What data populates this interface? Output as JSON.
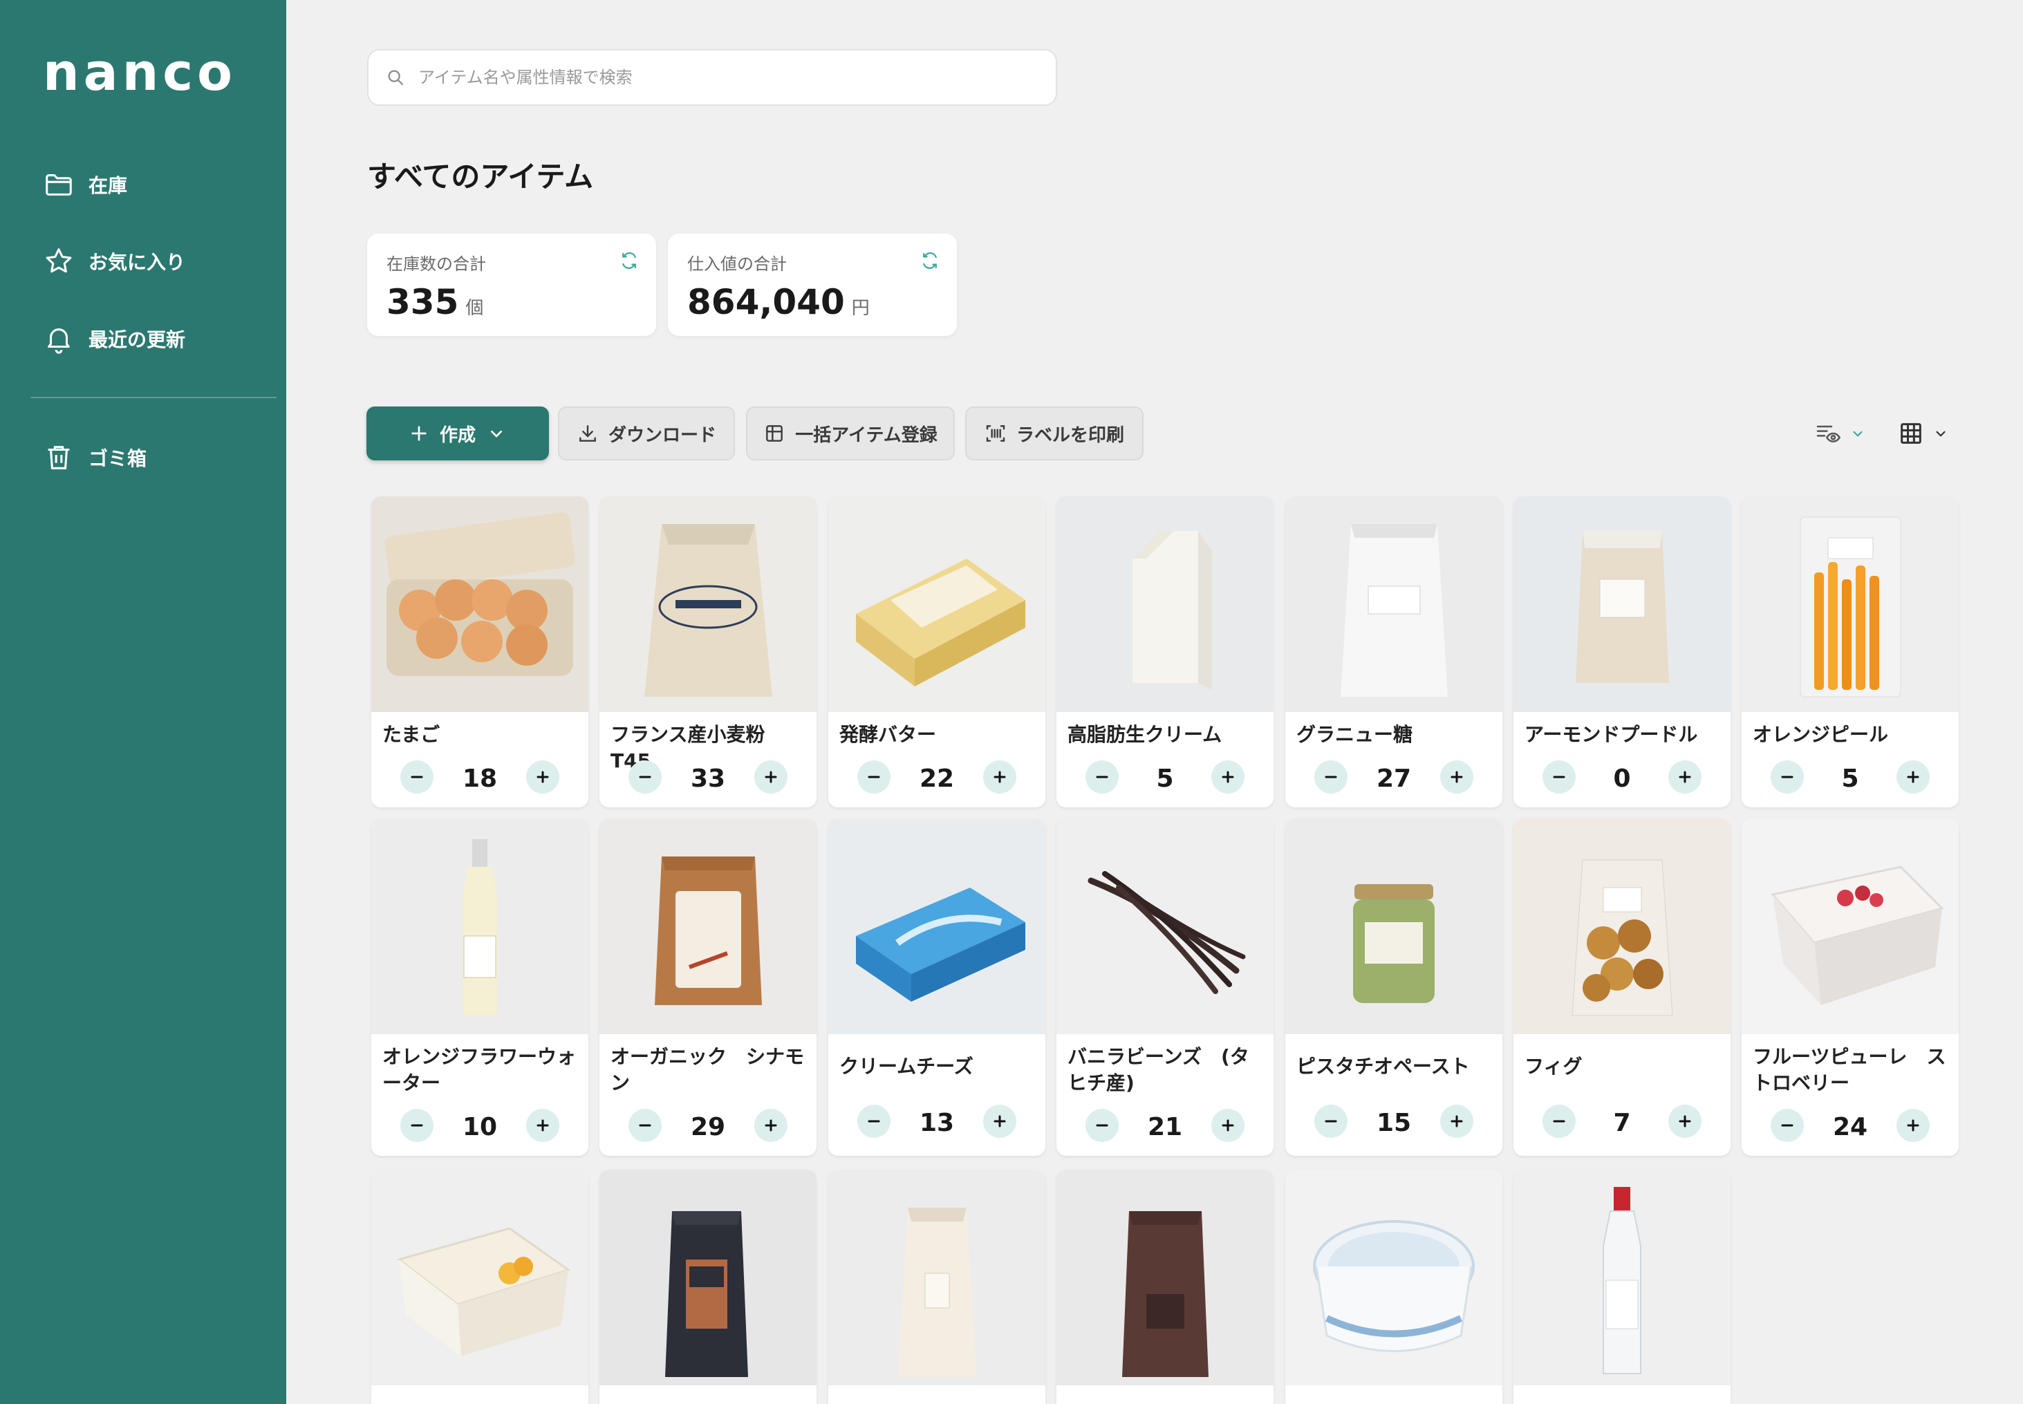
{
  "app": {
    "logo": "nanco"
  },
  "sidebar": {
    "items": [
      {
        "label": "在庫",
        "icon": "folder-icon"
      },
      {
        "label": "お気に入り",
        "icon": "star-icon"
      },
      {
        "label": "最近の更新",
        "icon": "bell-icon"
      },
      {
        "label": "ゴミ箱",
        "icon": "trash-icon"
      }
    ]
  },
  "search": {
    "placeholder": "アイテム名や属性情報で検索",
    "value": ""
  },
  "page": {
    "title": "すべてのアイテム"
  },
  "stats": [
    {
      "label": "在庫数の合計",
      "value": "335",
      "unit": "個"
    },
    {
      "label": "仕入値の合計",
      "value": "864,040",
      "unit": "円"
    }
  ],
  "toolbar": {
    "create_label": "作成",
    "download_label": "ダウンロード",
    "bulk_label": "一括アイテム登録",
    "print_label": "ラベルを印刷"
  },
  "items": [
    {
      "name": "たまご",
      "qty": "18"
    },
    {
      "name": "フランス産小麦粉 T45",
      "qty": "33"
    },
    {
      "name": "発酵バター",
      "qty": "22"
    },
    {
      "name": "高脂肪生クリーム",
      "qty": "5"
    },
    {
      "name": "グラニュー糖",
      "qty": "27"
    },
    {
      "name": "アーモンドプードル",
      "qty": "0"
    },
    {
      "name": "オレンジピール",
      "qty": "5"
    },
    {
      "name": "オレンジフラワーウォーター",
      "qty": "10"
    },
    {
      "name": "オーガニック　シナモン",
      "qty": "29"
    },
    {
      "name": "クリームチーズ",
      "qty": "13"
    },
    {
      "name": "バニラビーンズ　(タヒチ産)",
      "qty": "21"
    },
    {
      "name": "ピスタチオペースト",
      "qty": "15"
    },
    {
      "name": "フィグ",
      "qty": "7"
    },
    {
      "name": "フルーツピューレ　ストロベリー",
      "qty": "24"
    }
  ],
  "colors": {
    "brand": "#2b7870",
    "qty_button_bg": "#dcefed",
    "background": "#f0f0f0"
  }
}
